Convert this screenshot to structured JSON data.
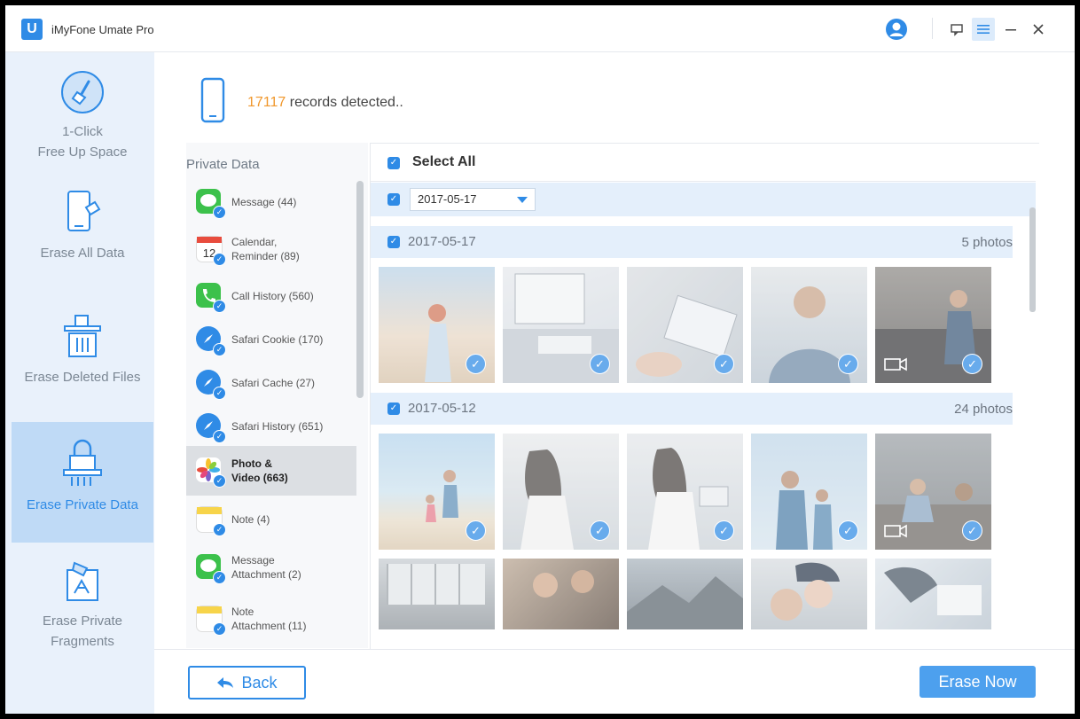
{
  "app": {
    "title": "iMyFone Umate Pro",
    "logo_letter": "U"
  },
  "sidebar": {
    "items": [
      {
        "label_line1": "1-Click",
        "label_line2": "Free Up Space",
        "icon": "broom-icon"
      },
      {
        "label_line1": "Erase All Data",
        "icon": "phone-erase-icon"
      },
      {
        "label_line1": "Erase Deleted Files",
        "icon": "trash-icon"
      },
      {
        "label_line1": "Erase Private Data",
        "icon": "lock-shredder-icon",
        "active": true
      },
      {
        "label_line1": "Erase Private",
        "label_line2": "Fragments",
        "icon": "fragments-icon"
      }
    ]
  },
  "header": {
    "record_count": "17117",
    "record_text": "records detected.."
  },
  "categories": {
    "title": "Private Data",
    "items": [
      {
        "line1": "Message (44)",
        "line2": "",
        "icon": "message-icon",
        "color": "#3cc14b"
      },
      {
        "line1": "Calendar,",
        "line2": "Reminder (89)",
        "icon": "calendar-icon",
        "color": "#ffffff"
      },
      {
        "line1": "Call History (560)",
        "line2": "",
        "icon": "phone-call-icon",
        "color": "#3cc14b"
      },
      {
        "line1": "Safari Cookie (170)",
        "line2": "",
        "icon": "safari-icon",
        "color": "#2f8be6"
      },
      {
        "line1": "Safari Cache (27)",
        "line2": "",
        "icon": "safari-icon",
        "color": "#2f8be6"
      },
      {
        "line1": "Safari History (651)",
        "line2": "",
        "icon": "safari-icon",
        "color": "#2f8be6"
      },
      {
        "line1": "Photo &",
        "line2": "Video (663)",
        "icon": "photos-icon",
        "color": "#f4f4f4",
        "active": true
      },
      {
        "line1": "Note (4)",
        "line2": "",
        "icon": "note-icon",
        "color": "#f7d44a"
      },
      {
        "line1": "Message",
        "line2": "Attachment (2)",
        "icon": "message-icon",
        "color": "#3cc14b"
      },
      {
        "line1": "Note",
        "line2": "Attachment (11)",
        "icon": "note-icon",
        "color": "#f7d44a"
      }
    ]
  },
  "photos": {
    "select_all_label": "Select All",
    "filter_date": "2017-05-17",
    "groups": [
      {
        "date": "2017-05-17",
        "count": "5 photos"
      },
      {
        "date": "2017-05-12",
        "count": "24 photos"
      }
    ]
  },
  "footer": {
    "back_label": "Back",
    "erase_label": "Erase Now"
  },
  "colors": {
    "accent": "#2f8be6",
    "count_orange": "#f0972b",
    "sidebar_bg": "#e9f1fb",
    "sidebar_active": "#bfdaf6"
  }
}
